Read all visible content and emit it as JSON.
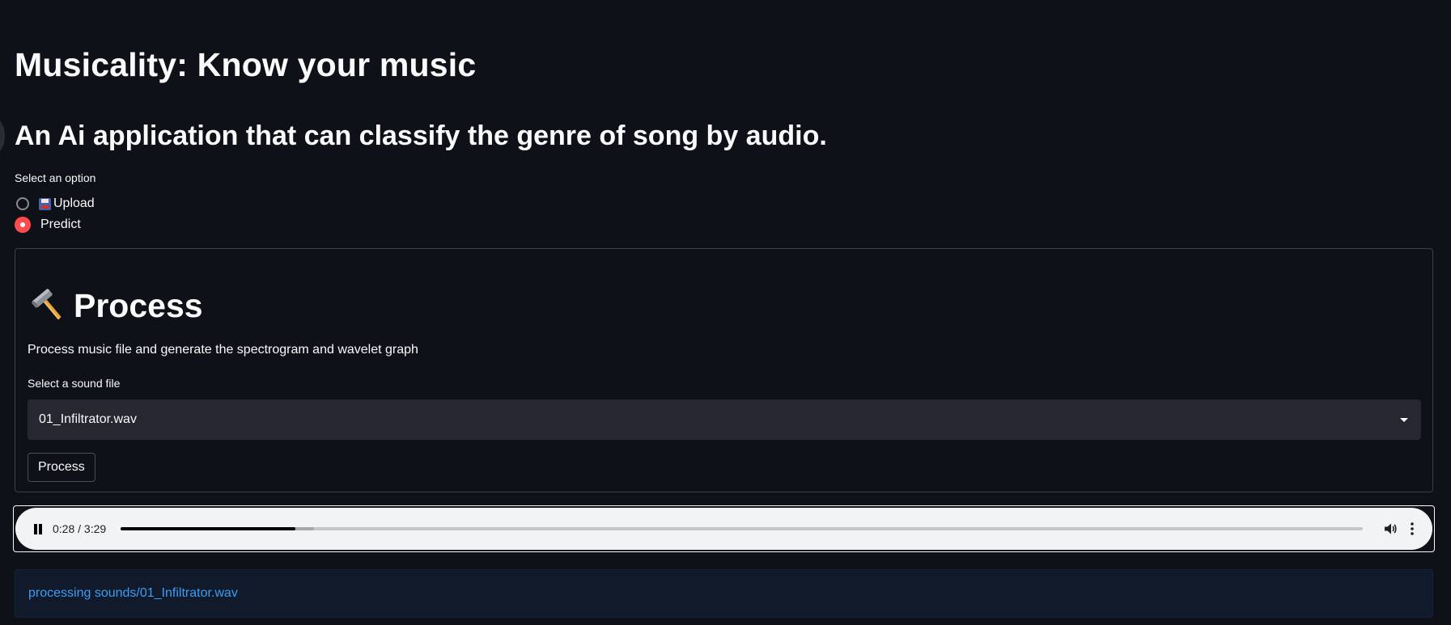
{
  "header": {
    "title": "Musicality: Know your music",
    "subtitle": "An Ai application that can classify the genre of song by audio."
  },
  "option_radio": {
    "label": "Select an option",
    "options": [
      {
        "label": "Upload",
        "icon": "floppy-disk-icon",
        "selected": false
      },
      {
        "label": "Predict",
        "selected": true
      }
    ],
    "selected_color": "#ff4b4b"
  },
  "process_section": {
    "icon": "hammer-icon",
    "title": "Process",
    "description": "Process music file and generate the spectrogram and wavelet graph",
    "select_label": "Select a sound file",
    "selected_file": "01_Infiltrator.wav",
    "button_label": "Process"
  },
  "audio_player": {
    "time": "0:28 / 3:29",
    "progress_fraction": 0.141,
    "buffered_fraction": 0.156,
    "state": "playing"
  },
  "status_message": {
    "text": "processing sounds/01_Infiltrator.wav",
    "color": "#3d9df3"
  },
  "theme": {
    "background": "#0e1117",
    "text": "#fafafa",
    "widget_background": "#262730"
  }
}
